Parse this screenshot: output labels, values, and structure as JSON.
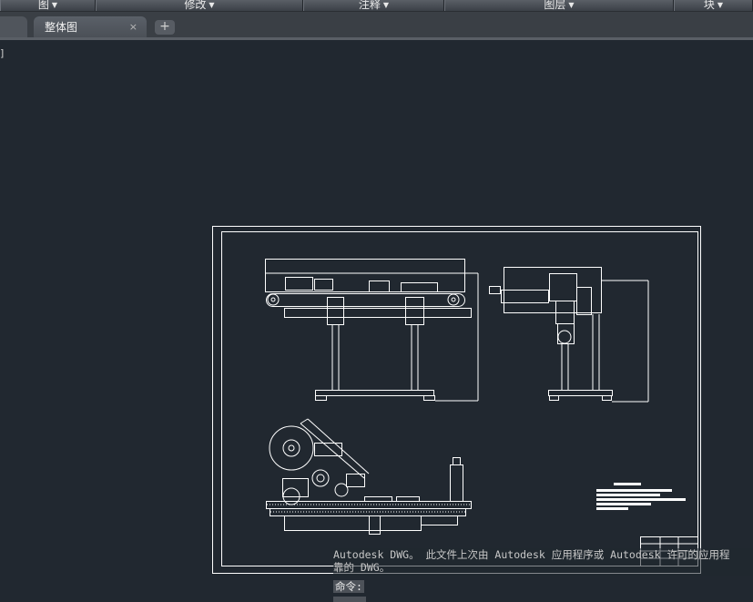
{
  "ribbon": {
    "panels": [
      {
        "label": "图",
        "has_arrow": true
      },
      {
        "label": "修改",
        "has_arrow": true
      },
      {
        "label": "注释",
        "has_arrow": true
      },
      {
        "label": "图层",
        "has_arrow": true
      },
      {
        "label": "块",
        "has_arrow": true
      }
    ]
  },
  "tabs": {
    "active_label": "整体图",
    "close_glyph": "×",
    "add_glyph": "+"
  },
  "viewport": {
    "label_fragment": "]"
  },
  "command_line": {
    "history": [
      "Autodesk DWG。  此文件上次由 Autodesk 应用程序或 Autodesk 许可的应用程",
      "靠的 DWG。"
    ],
    "prompt": "命令:"
  },
  "colors": {
    "canvas": "#212830",
    "linework": "#ffffff",
    "ribbon": "#4a4f56"
  }
}
